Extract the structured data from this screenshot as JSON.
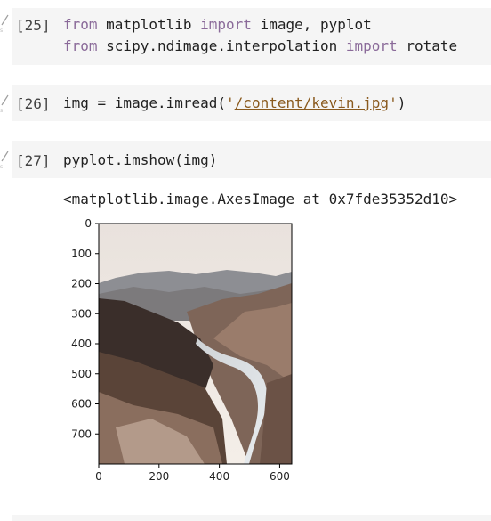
{
  "cells": [
    {
      "prompt": "[25]",
      "lines": [
        [
          {
            "t": "from",
            "k": "kw"
          },
          {
            "t": " matplotlib ",
            "k": ""
          },
          {
            "t": "import",
            "k": "kw"
          },
          {
            "t": " image, pyplot",
            "k": ""
          }
        ],
        [
          {
            "t": "from",
            "k": "kw"
          },
          {
            "t": " scipy.ndimage.interpolation ",
            "k": ""
          },
          {
            "t": "import",
            "k": "kw"
          },
          {
            "t": " rotate",
            "k": ""
          }
        ]
      ]
    },
    {
      "prompt": "[26]",
      "lines": [
        [
          {
            "t": "img = image.imread(",
            "k": ""
          },
          {
            "t": "'",
            "k": "str"
          },
          {
            "t": "/content/kevin.jpg",
            "k": "str path"
          },
          {
            "t": "'",
            "k": "str"
          },
          {
            "t": ")",
            "k": ""
          }
        ]
      ]
    },
    {
      "prompt": "[27]",
      "lines": [
        [
          {
            "t": "pyplot.imshow(img)",
            "k": ""
          }
        ]
      ]
    }
  ],
  "output": {
    "text": "<matplotlib.image.AxesImage at 0x7fde35352d10>"
  },
  "chart_data": {
    "type": "image",
    "x_ticks": [
      0,
      200,
      400,
      600
    ],
    "y_ticks": [
      0,
      100,
      200,
      300,
      400,
      500,
      600,
      700
    ],
    "xlim": [
      0,
      640
    ],
    "ylim": [
      800,
      0
    ],
    "image_description": "mountain-landscape"
  },
  "colors": {
    "cell_bg": "#f5f5f5",
    "keyword": "#8a6a99",
    "string": "#8a5a1e",
    "text": "#212121"
  }
}
